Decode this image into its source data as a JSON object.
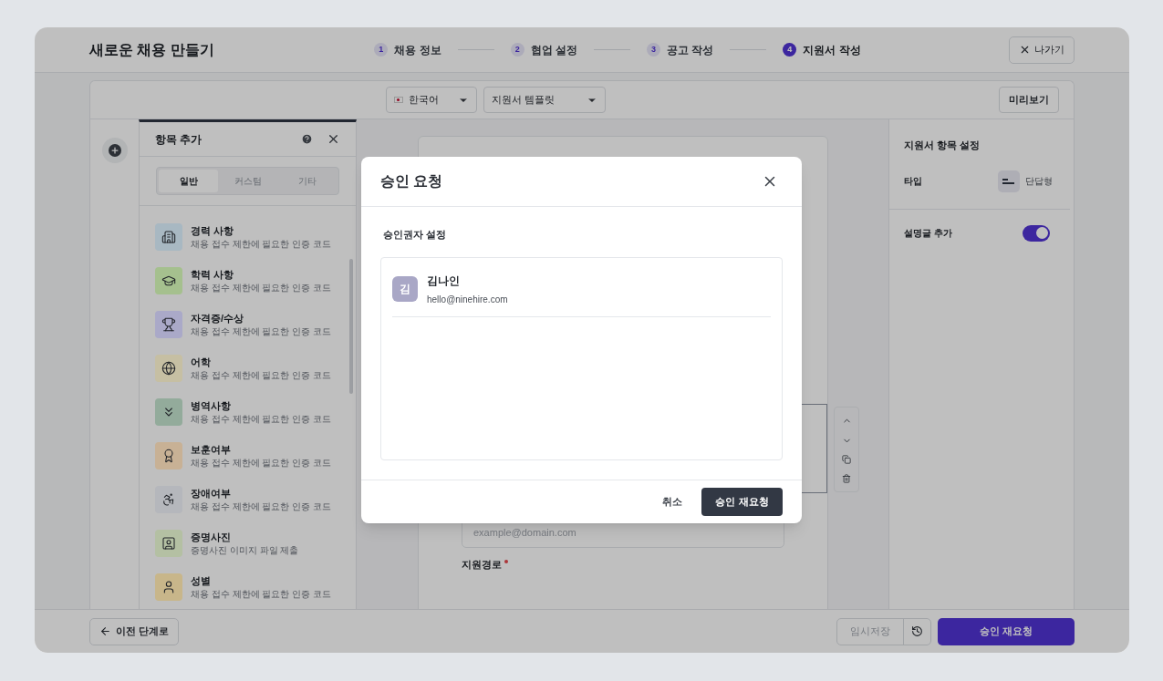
{
  "header": {
    "title": "새로운 채용 만들기",
    "exit_button": "나가기"
  },
  "steps": [
    {
      "number": "1",
      "label": "채용 정보",
      "selected": false
    },
    {
      "number": "2",
      "label": "협업 설정",
      "selected": false
    },
    {
      "number": "3",
      "label": "공고 작성",
      "selected": false
    },
    {
      "number": "4",
      "label": "지원서 작성",
      "selected": true
    }
  ],
  "toolbar": {
    "language": "한국어",
    "template": "지원서 템플릿",
    "preview_button": "미리보기"
  },
  "item_panel": {
    "title": "항목 추가",
    "tabs": [
      {
        "label": "일반",
        "selected": true
      },
      {
        "label": "커스텀",
        "selected": false
      },
      {
        "label": "기타",
        "selected": false
      }
    ],
    "items": [
      {
        "kind": "building",
        "title": "경력 사항",
        "description": "채용 접수 제한에 필요한 인증 코드",
        "color": "#a8b8c2"
      },
      {
        "kind": "graduation",
        "title": "학력 사항",
        "description": "채용 접수 제한에 필요한 인증 코드",
        "color": "#a5c08e"
      },
      {
        "kind": "trophy",
        "title": "자격증/수상",
        "description": "채용 접수 제한에 필요한 인증 코드",
        "color": "#aaa9c8"
      },
      {
        "kind": "globe",
        "title": "어학",
        "description": "채용 접수 제한에 필요한 인증 코드",
        "color": "#c6bfa3"
      },
      {
        "kind": "chevrons",
        "title": "병역사항",
        "description": "채용 접수 제한에 필요한 인증 코드",
        "color": "#93ab9b"
      },
      {
        "kind": "award",
        "title": "보훈여부",
        "description": "채용 접수 제한에 필요한 인증 코드",
        "color": "#c8b195"
      },
      {
        "kind": "accessibility",
        "title": "장애여부",
        "description": "채용 접수 제한에 필요한 인증 코드",
        "color": "#b5b7bc"
      },
      {
        "kind": "portrait",
        "title": "증명사진",
        "description": "증명사진 이미지 파일 제출",
        "color": "#b4c0a3"
      },
      {
        "kind": "person",
        "title": "성별",
        "description": "채용 접수 제한에 필요한 인증 코드",
        "color": "#c8b68a"
      }
    ]
  },
  "form": {
    "email_placeholder": "example@domain.com",
    "next_label": "지원경로",
    "next_required": true
  },
  "settings_panel": {
    "title": "지원서 항목 설정",
    "type_label": "타입",
    "type_value": "단답형",
    "description_label": "설명글 추가",
    "description_on": true
  },
  "footer": {
    "back_button": "이전 단계로",
    "draft_button": "임시저장",
    "draft_disabled": true,
    "submit_button": "승인 재요청"
  },
  "modal": {
    "title": "승인 요청",
    "section_title": "승인권자 설정",
    "approvers": [
      {
        "initial": "김",
        "name": "김나인",
        "email": "hello@ninehire.com"
      }
    ],
    "cancel_button": "취소",
    "confirm_button": "승인 재요청"
  }
}
